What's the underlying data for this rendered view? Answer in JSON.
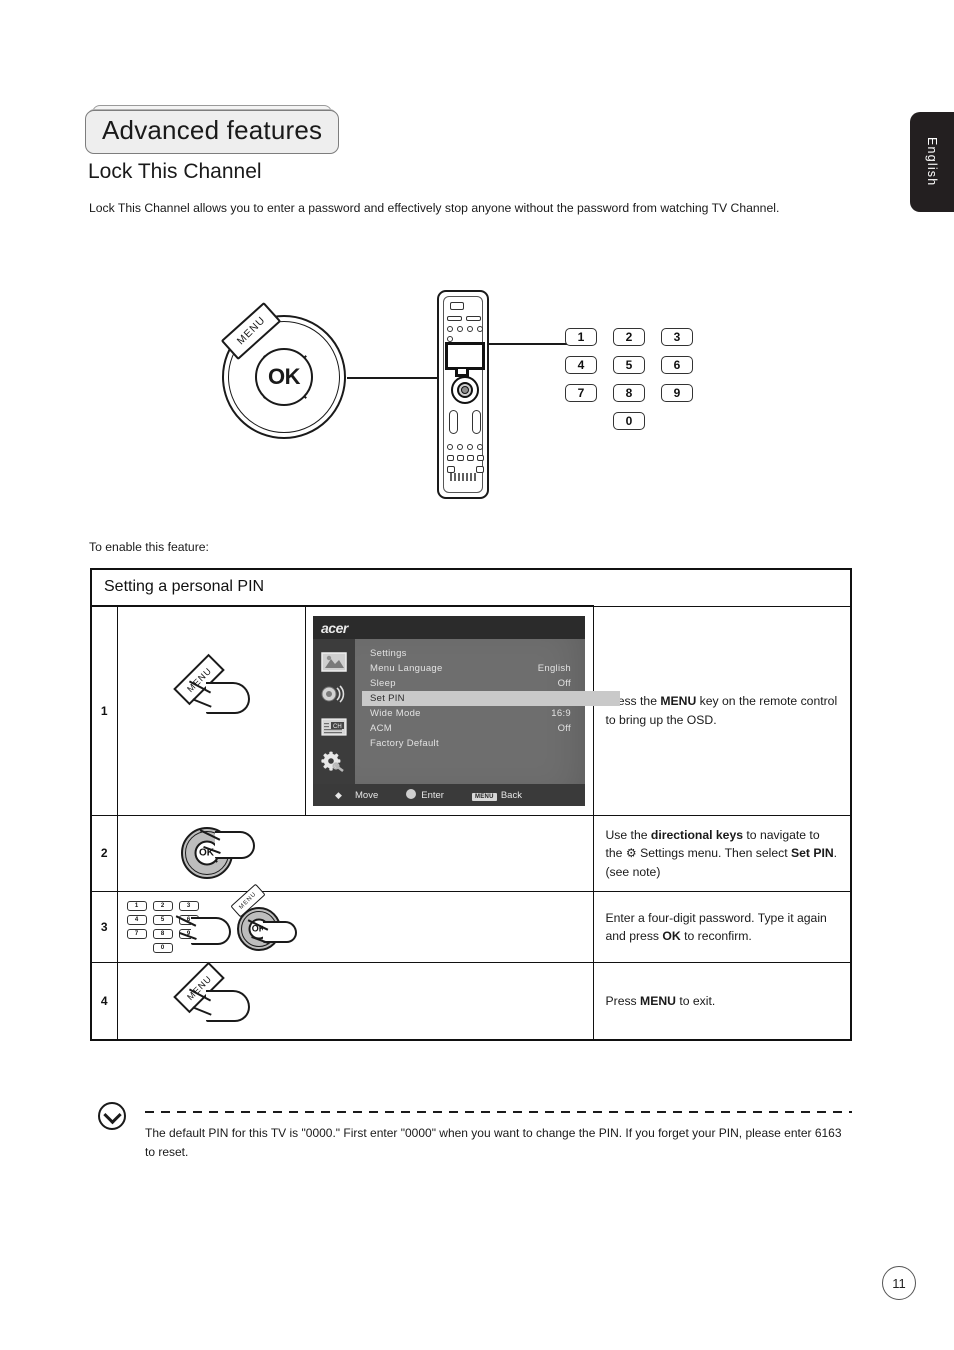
{
  "header": {
    "chapter_title": "Advanced features",
    "section_title": "Lock This Channel",
    "intro": "Lock This Channel allows you to enter a password and effectively stop anyone without the password from watching TV Channel.",
    "language_tab": "English"
  },
  "diagram": {
    "ok_label": "OK",
    "menu_label": "MENU",
    "keypad": [
      "1",
      "2",
      "3",
      "4",
      "5",
      "6",
      "7",
      "8",
      "9",
      "0"
    ]
  },
  "enable_text": "To enable this feature:",
  "table": {
    "header": "Setting a personal PIN",
    "rows": [
      {
        "num": "1",
        "text_html": "Press the <b>MENU</b> key on the remote control to bring up the OSD."
      },
      {
        "num": "2",
        "text_html": "Use the <b>directional keys</b> to navigate to the &#9881; Settings menu. Then select <b>Set PIN</b>.<br>(see note)"
      },
      {
        "num": "3",
        "text_html": "Enter a four-digit password. Type it again and press <b>OK</b> to reconfirm."
      },
      {
        "num": "4",
        "text_html": "Press <b>MENU</b> to exit."
      }
    ]
  },
  "osd": {
    "brand": "acer",
    "title": "Settings",
    "items": [
      {
        "label": "Menu Language",
        "value": "English",
        "selected": false
      },
      {
        "label": "Sleep",
        "value": "Off",
        "selected": false
      },
      {
        "label": "Set PIN",
        "value": "",
        "selected": true
      },
      {
        "label": "Wide Mode",
        "value": "16:9",
        "selected": false
      },
      {
        "label": "ACM",
        "value": "Off",
        "selected": false
      },
      {
        "label": "Factory Default",
        "value": "",
        "selected": false
      }
    ],
    "footer": {
      "move": "Move",
      "enter": "Enter",
      "back_key": "MENU",
      "back": "Back"
    },
    "sidebar_icons": [
      "picture-icon",
      "sound-icon",
      "channel-icon",
      "settings-gear-icon"
    ]
  },
  "note": {
    "text": "The default PIN for this TV is \"0000.\" First enter \"0000\" when you want to change the PIN. If you forget your PIN, please enter 6163 to reset."
  },
  "page_number": "11"
}
